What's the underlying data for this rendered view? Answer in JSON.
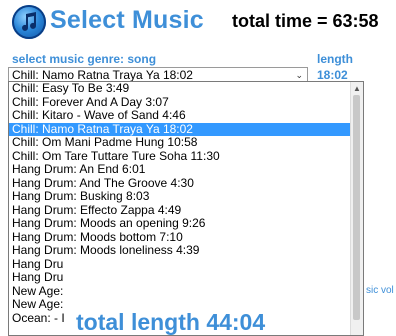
{
  "header": {
    "title": "Select Music",
    "total_time": "total time = 63:58"
  },
  "labels": {
    "genre": "select music genre: song",
    "length": "length"
  },
  "select": {
    "value": "Chill: Namo Ratna Traya Ya 18:02",
    "length_value": "18:02"
  },
  "options": [
    "Chill: Easy To Be 3:49",
    "Chill: Forever And A Day 3:07",
    "Chill: Kitaro - Wave of Sand 4:46",
    "Chill: Namo Ratna Traya Ya 18:02",
    "Chill: Om Mani Padme Hung 10:58",
    "Chill: Om Tare Tuttare Ture Soha 11:30",
    "Hang Drum: An End 6:01",
    "Hang Drum: And The Groove 4:30",
    "Hang Drum: Busking 8:03",
    "Hang Drum: Effecto Zappa 4:49",
    "Hang Drum: Moods an opening 9:26",
    "Hang Drum: Moods bottom 7:10",
    "Hang Drum: Moods loneliness 4:39",
    "Hang Dru",
    "Hang Dru",
    "New Age:",
    "New Age:",
    "Ocean: - I"
  ],
  "selected_index": 3,
  "music_vol": "sic vol",
  "total_length": "total length 44:04"
}
